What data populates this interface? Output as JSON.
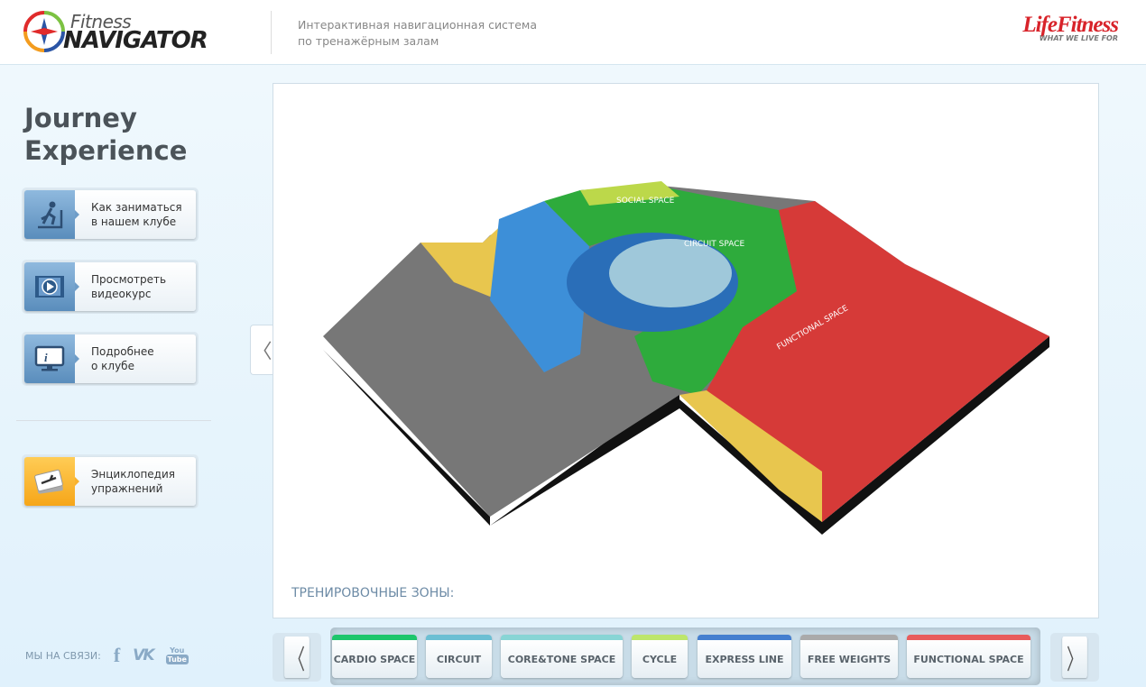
{
  "header": {
    "logo_top": "Fitness",
    "logo_bottom": "NAVIGATOR",
    "tagline_line1": "Интерактивная навигационная система",
    "tagline_line2": "по тренажёрным залам",
    "brand": "LifeFitness",
    "brand_slogan": "WHAT WE LIVE FOR"
  },
  "sidebar": {
    "title_line1": "Journey",
    "title_line2": "Experience",
    "items": [
      {
        "line1": "Как заниматься",
        "line2": "в нашем клубе",
        "icon": "treadmill-runner-icon"
      },
      {
        "line1": "Просмотреть",
        "line2": "видеокурс",
        "icon": "video-play-icon"
      },
      {
        "line1": "Подробнее",
        "line2": "о клубе",
        "icon": "info-monitor-icon"
      },
      {
        "line1": "Энциклопедия",
        "line2": "упражнений",
        "icon": "exercise-cards-icon"
      }
    ],
    "social_label": "МЫ НА СВЯЗИ:",
    "social": {
      "facebook": "f",
      "vk": "VK",
      "youtube_top": "You",
      "youtube_bottom": "Tube"
    }
  },
  "main": {
    "zones_label": "ТРЕНИРОВОЧНЫЕ ЗОНЫ:",
    "map_labels": {
      "social": "SOCIAL SPACE",
      "circuit": "CIRCUIT SPACE",
      "functional": "FUNCTIONAL SPACE"
    }
  },
  "zones": [
    {
      "label": "CARDIO SPACE",
      "color": "#1dc66b"
    },
    {
      "label": "CIRCUIT",
      "color": "#6cbfd3"
    },
    {
      "label": "CORE&TONE SPACE",
      "color": "#88d5d5"
    },
    {
      "label": "CYCLE",
      "color": "#bde66b"
    },
    {
      "label": "EXPRESS LINE",
      "color": "#457fcf"
    },
    {
      "label": "FREE WEIGHTS",
      "color": "#aaaaaa"
    },
    {
      "label": "FUNCTIONAL SPACE",
      "color": "#e85c5c"
    }
  ],
  "nav": {
    "prev": "〈",
    "next": "〉",
    "panel_prev": "〈"
  }
}
